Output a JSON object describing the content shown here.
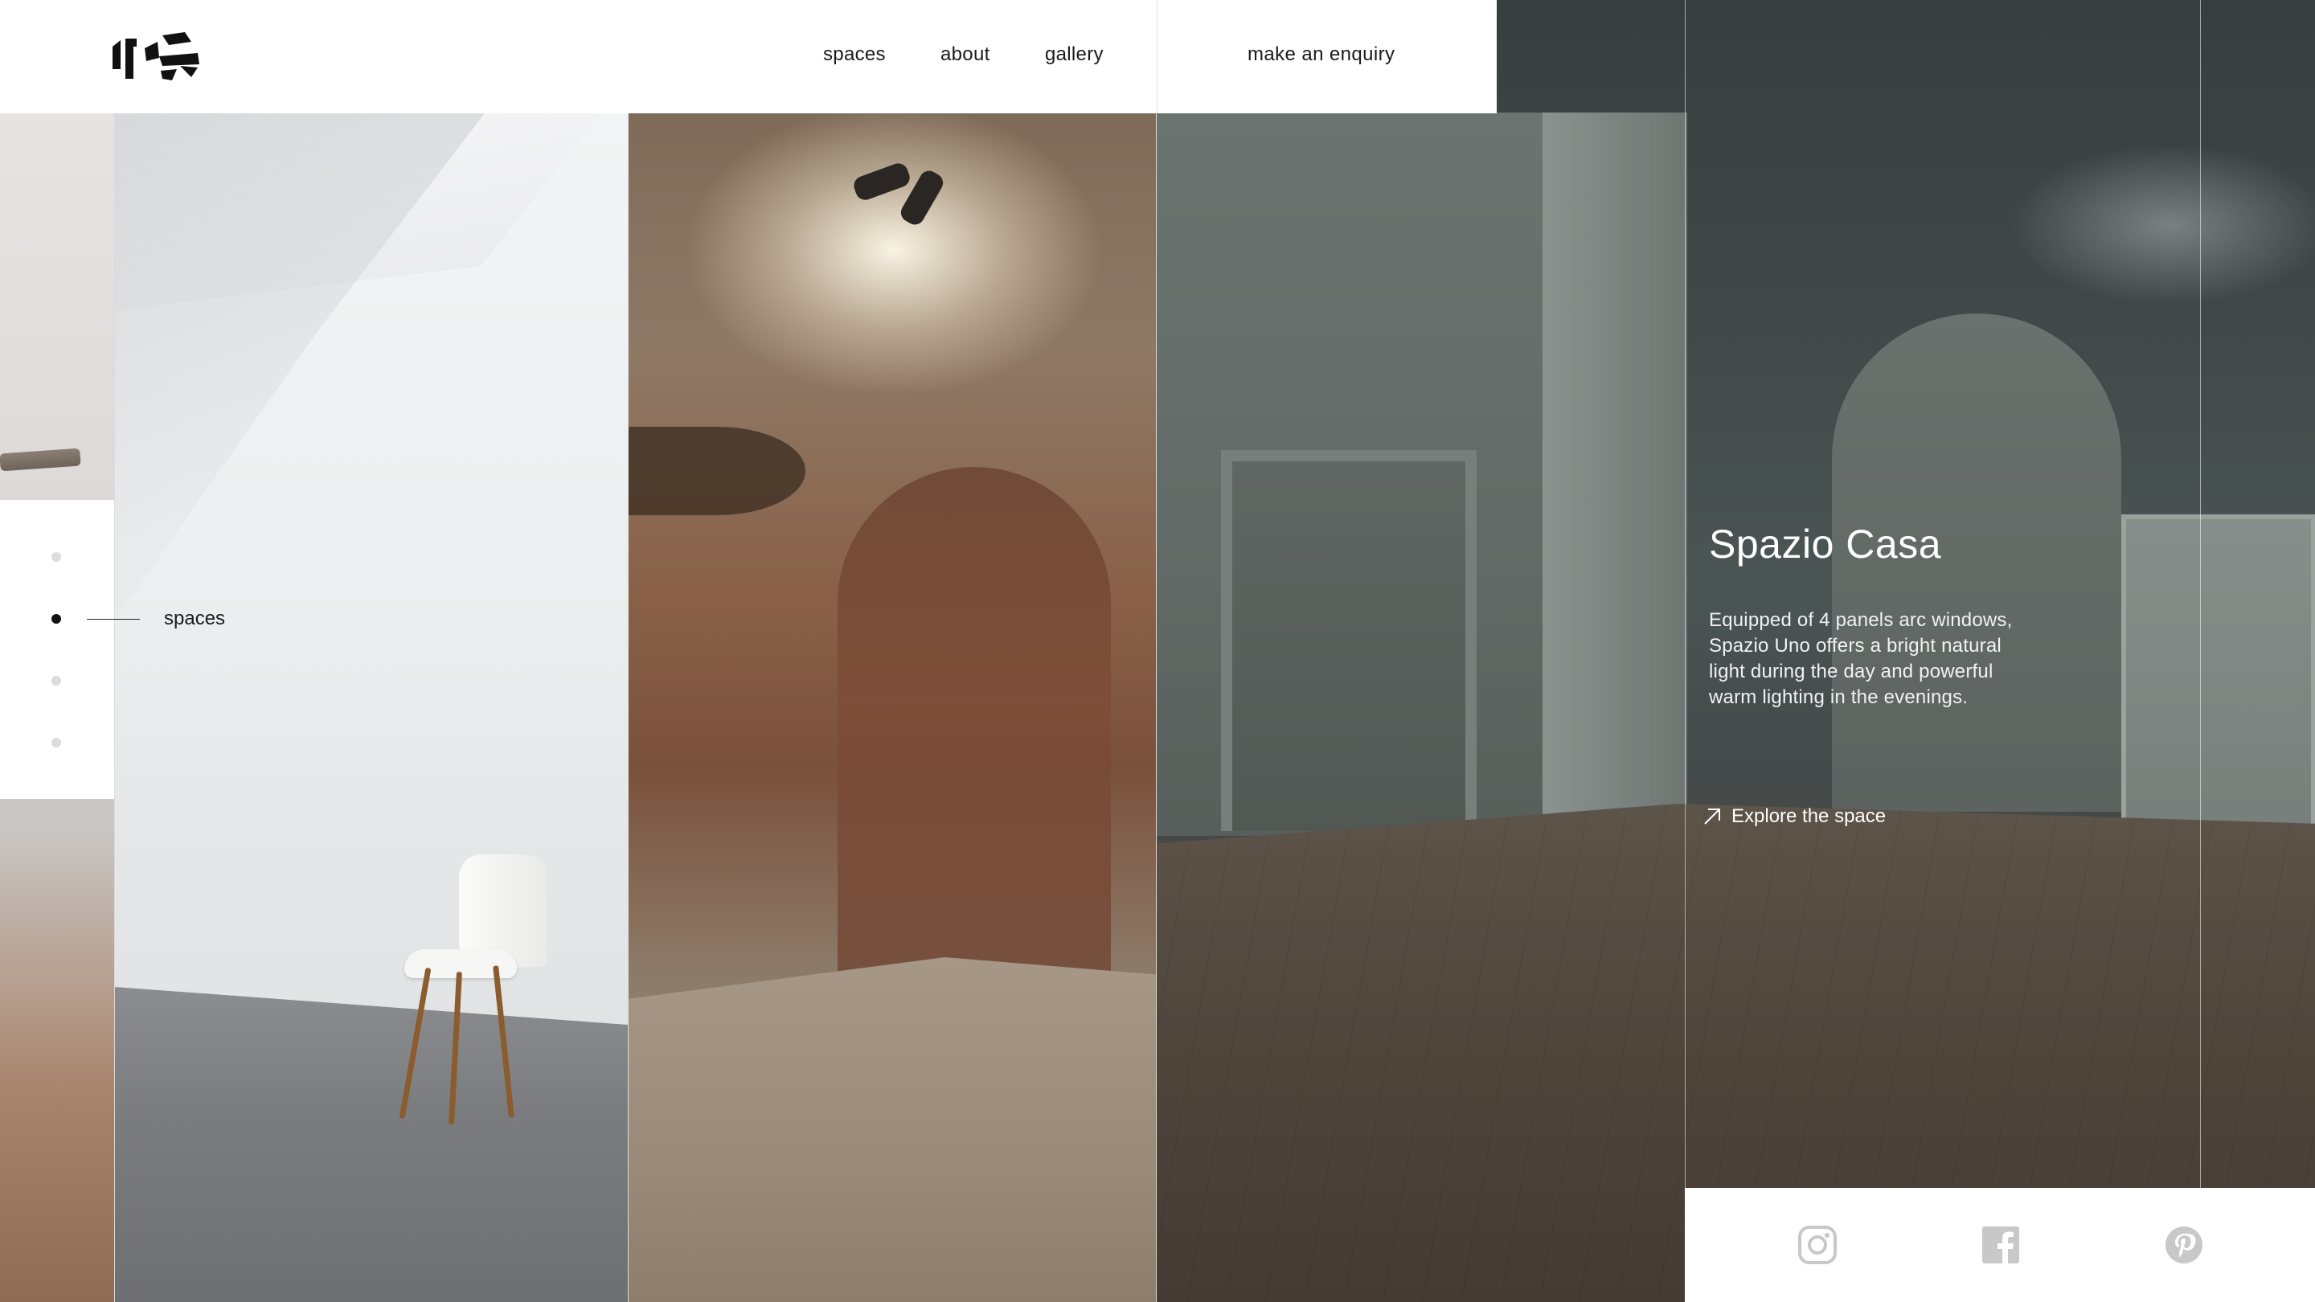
{
  "header": {
    "logo_alt": "ts",
    "nav": [
      {
        "label": "spaces"
      },
      {
        "label": "about"
      },
      {
        "label": "gallery"
      }
    ],
    "enquiry_label": "make an enquiry"
  },
  "pager": {
    "dots": 4,
    "active_index": 1,
    "active_label": "spaces"
  },
  "space": {
    "title": "Spazio Casa",
    "description": "Equipped of 4 panels arc windows, Spazio Uno offers a bright natural light during the day and powerful warm lighting in the evenings.",
    "cta_label": "Explore the space",
    "cta_icon": "arrow-up-right-icon"
  },
  "social": [
    {
      "icon": "instagram-icon"
    },
    {
      "icon": "facebook-icon"
    },
    {
      "icon": "pinterest-icon"
    }
  ],
  "colors": {
    "text": "#1a1a1a",
    "social_icon": "#c8c8c8",
    "panel_text": "#ffffff"
  }
}
